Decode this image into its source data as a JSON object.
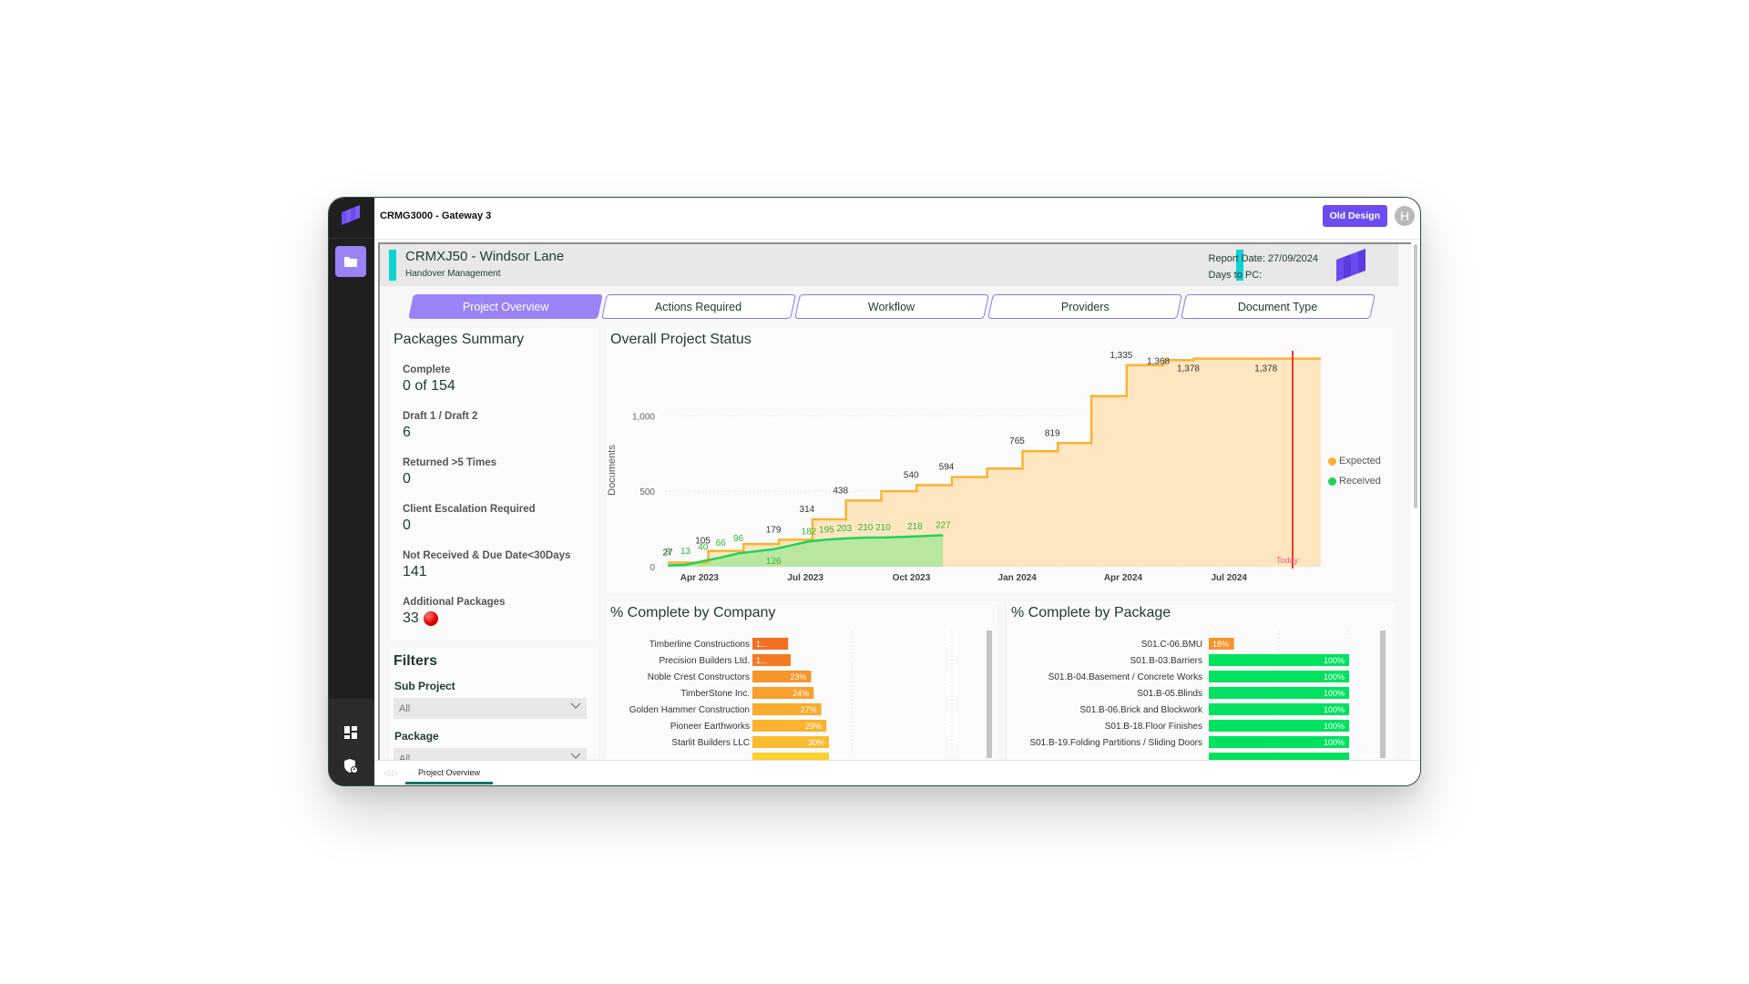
{
  "app": {
    "title": "CRMG3000 - Gateway 3",
    "old_design_label": "Old Design",
    "avatar_initial": "H",
    "sidebar": [
      {
        "icon": "app-logo-icon"
      },
      {
        "icon": "folder-icon",
        "active": true
      },
      {
        "icon": "dashboard-icon"
      },
      {
        "icon": "shield-user-icon"
      }
    ]
  },
  "header": {
    "project_title": "CRMXJ50 - Windsor Lane",
    "project_subtitle": "Handover Management",
    "report_date": "Report Date: 27/09/2024",
    "days_to_pc": "Days to PC:"
  },
  "tabs": [
    {
      "label": "Project Overview",
      "active": true
    },
    {
      "label": "Actions Required",
      "active": false
    },
    {
      "label": "Workflow",
      "active": false
    },
    {
      "label": "Providers",
      "active": false
    },
    {
      "label": "Document Type",
      "active": false
    }
  ],
  "packages_summary": {
    "title": "Packages Summary",
    "kpis": [
      {
        "label": "Complete",
        "value": "0 of 154"
      },
      {
        "label": "Draft 1 / Draft 2",
        "value": "6"
      },
      {
        "label": "Returned >5 Times",
        "value": "0"
      },
      {
        "label": "Client Escalation Required",
        "value": "0"
      },
      {
        "label": "Not Received & Due Date<30Days",
        "value": "141"
      },
      {
        "label": "Additional Packages",
        "value": "33",
        "indicator": "red"
      }
    ]
  },
  "filters": {
    "title": "Filters",
    "sub_project_label": "Sub Project",
    "sub_project_value": "All",
    "package_label": "Package",
    "package_value": "All"
  },
  "footer": {
    "page_tab": "Project Overview"
  },
  "chart_data": [
    {
      "type": "area",
      "title": "Overall Project Status",
      "ylabel": "Documents",
      "xlabel": "",
      "ylim": [
        0,
        1400
      ],
      "yticks": [
        0,
        500,
        1000
      ],
      "ytick_labels": [
        "0",
        "500",
        "1,000"
      ],
      "xticks": [
        "Apr 2023",
        "Jul 2023",
        "Oct 2023",
        "Jan 2024",
        "Apr 2024",
        "Jul 2024"
      ],
      "grid": true,
      "legend": "right",
      "today_marker": {
        "label": "Today",
        "color": "#ee3b2b"
      },
      "series": [
        {
          "name": "Expected",
          "color": "#f9b234",
          "fill": "#fde6c0",
          "step": true,
          "points": [
            {
              "t": 0.0,
              "v": 27,
              "label": "27"
            },
            {
              "t": 1.15,
              "v": 105,
              "label": "105"
            },
            {
              "t": 2.0,
              "v": 105
            },
            {
              "t": 2.15,
              "v": 150
            },
            {
              "t": 3.0,
              "v": 150
            },
            {
              "t": 3.15,
              "v": 179,
              "label": "179"
            },
            {
              "t": 4.05,
              "v": 179
            },
            {
              "t": 4.1,
              "v": 314,
              "label": "314"
            },
            {
              "t": 5.0,
              "v": 314
            },
            {
              "t": 5.05,
              "v": 438,
              "label": "438"
            },
            {
              "t": 6.0,
              "v": 438
            },
            {
              "t": 6.05,
              "v": 500
            },
            {
              "t": 7.0,
              "v": 500
            },
            {
              "t": 7.05,
              "v": 540,
              "label": "540"
            },
            {
              "t": 8.0,
              "v": 540
            },
            {
              "t": 8.05,
              "v": 594,
              "label": "594"
            },
            {
              "t": 9.0,
              "v": 594
            },
            {
              "t": 9.05,
              "v": 650
            },
            {
              "t": 10.0,
              "v": 650
            },
            {
              "t": 10.05,
              "v": 765,
              "label": "765"
            },
            {
              "t": 11.0,
              "v": 765
            },
            {
              "t": 11.05,
              "v": 819,
              "label": "819"
            },
            {
              "t": 11.95,
              "v": 819
            },
            {
              "t": 12.0,
              "v": 1130
            },
            {
              "t": 12.95,
              "v": 1130
            },
            {
              "t": 13.0,
              "v": 1335,
              "label": "1,335"
            },
            {
              "t": 14.0,
              "v": 1335
            },
            {
              "t": 14.05,
              "v": 1368,
              "label": "1,368"
            },
            {
              "t": 14.9,
              "v": 1378,
              "label": "1,378"
            },
            {
              "t": 17.1,
              "v": 1378,
              "label": "1,378"
            },
            {
              "t": 18.5,
              "v": 1378
            }
          ]
        },
        {
          "name": "Received",
          "color": "#1fd35a",
          "fill": "#b9e6a0",
          "step": false,
          "points": [
            {
              "t": 0.0,
              "v": 9,
              "label": "9"
            },
            {
              "t": 0.5,
              "v": 13,
              "label": "13"
            },
            {
              "t": 1.0,
              "v": 40,
              "label": "40"
            },
            {
              "t": 1.5,
              "v": 66,
              "label": "66"
            },
            {
              "t": 2.0,
              "v": 96,
              "label": "96"
            },
            {
              "t": 3.0,
              "v": 126,
              "label": "126"
            },
            {
              "t": 4.0,
              "v": 182,
              "label": "182"
            },
            {
              "t": 4.5,
              "v": 195,
              "label": "195"
            },
            {
              "t": 5.0,
              "v": 203,
              "label": "203"
            },
            {
              "t": 5.6,
              "v": 210,
              "label": "210"
            },
            {
              "t": 6.1,
              "v": 210,
              "label": "210"
            },
            {
              "t": 7.0,
              "v": 218,
              "label": "218"
            },
            {
              "t": 7.8,
              "v": 227,
              "label": "227"
            }
          ]
        }
      ],
      "x_tick_positions_months_from_start": [
        0.9,
        3.9,
        6.9,
        9.9,
        12.9,
        15.9
      ]
    },
    {
      "type": "bar",
      "title": "% Complete by Company",
      "orientation": "horizontal",
      "xlim": [
        0,
        100
      ],
      "categories": [
        "Timberline Constructions",
        "Precision Builders Ltd.",
        "Noble Crest Constructors",
        "TimberStone Inc.",
        "Golden Hammer Construction",
        "Pioneer Earthworks",
        "Starlit Builders LLC"
      ],
      "values": [
        14,
        15,
        23,
        24,
        27,
        29,
        30
      ],
      "value_labels": [
        "1...",
        "1...",
        "23%",
        "24%",
        "27%",
        "29%",
        "30%"
      ],
      "colors": [
        "#f36f21",
        "#f47a22",
        "#f7952a",
        "#f8a12c",
        "#f8ac2d",
        "#f9b32e",
        "#f9bb2f"
      ]
    },
    {
      "type": "bar",
      "title": "% Complete by Package",
      "orientation": "horizontal",
      "xlim": [
        0,
        100
      ],
      "categories": [
        "S01.C-06.BMU",
        "S01.B-03.Barriers",
        "S01.B-04.Basement / Concrete Works",
        "S01.B-05.Blinds",
        "S01.B-06.Brick and Blockwork",
        "S01.B-18.Floor Finishes",
        "S01.B-19.Folding Partitions / Sliding Doors"
      ],
      "values": [
        18,
        100,
        100,
        100,
        100,
        100,
        100
      ],
      "value_labels": [
        "18%",
        "100%",
        "100%",
        "100%",
        "100%",
        "100%",
        "100%"
      ],
      "colors": [
        "#f7952a",
        "#00e160",
        "#00e160",
        "#00e160",
        "#00e160",
        "#00e160",
        "#00e160"
      ]
    }
  ]
}
